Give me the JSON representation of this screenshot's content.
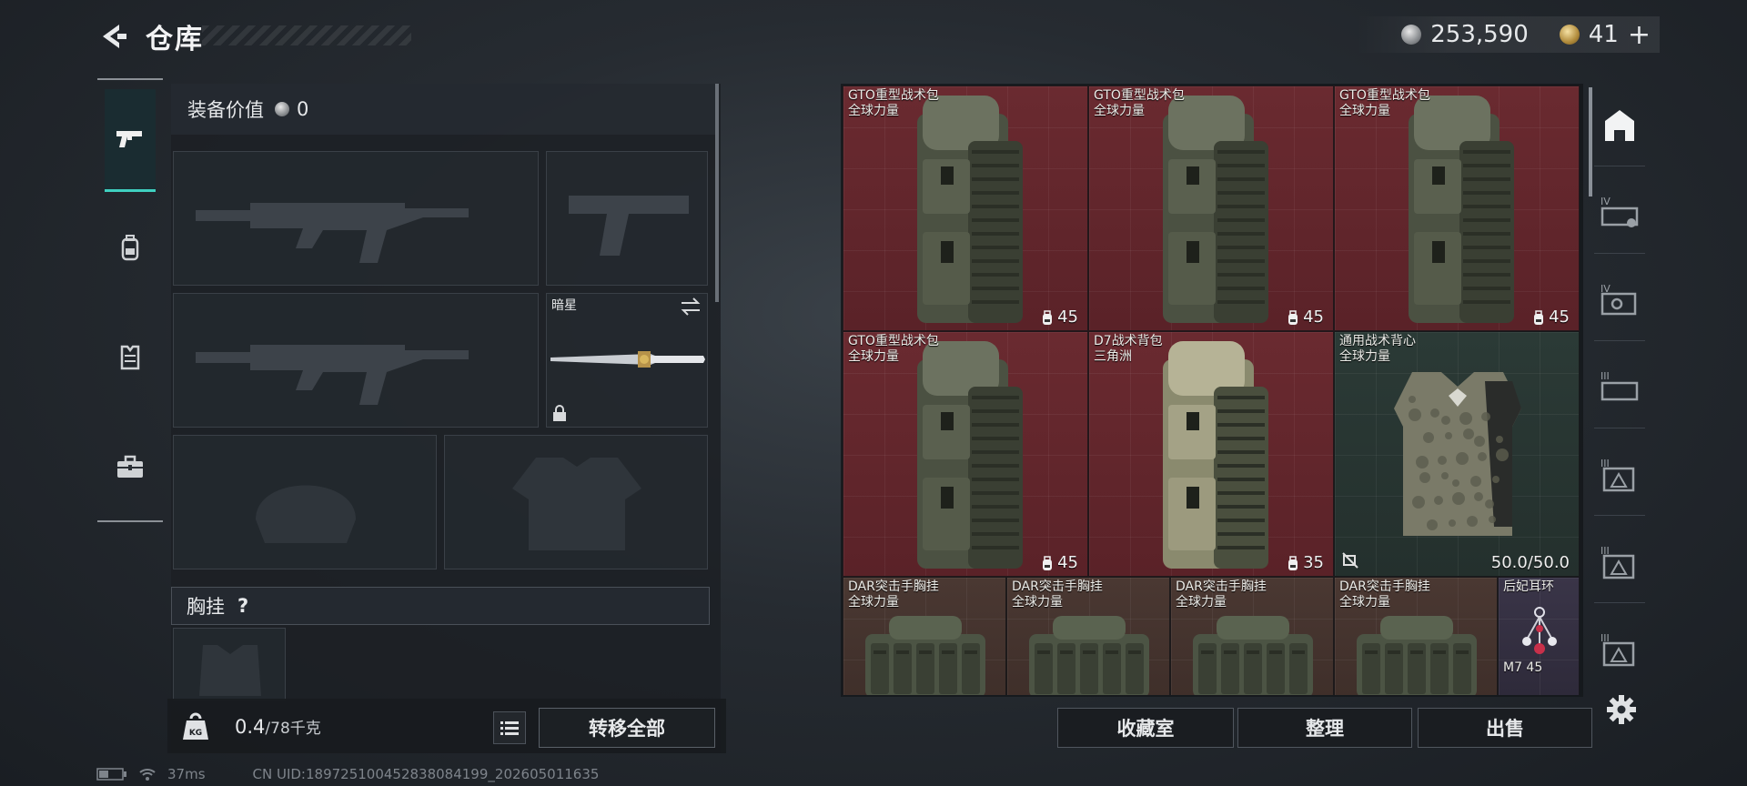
{
  "header": {
    "title": "仓库",
    "back_icon": "back-arrow-icon"
  },
  "currency": {
    "silver_amount": "253,590",
    "gold_amount": "41",
    "gold_add": "+"
  },
  "left_tabs": [
    {
      "icon": "pistol-icon",
      "active": true
    },
    {
      "icon": "backpack-icon",
      "active": false
    },
    {
      "icon": "vest-icon",
      "active": false
    },
    {
      "icon": "briefcase-icon",
      "active": false
    }
  ],
  "loadout": {
    "value_label": "装备价值",
    "value_amount": "0",
    "melee_name": "暗星",
    "chest_rig_label": "胸挂",
    "help_symbol": "?"
  },
  "weight": {
    "current": "0.4",
    "max": "/78千克",
    "kg_icon_label": "KG"
  },
  "buttons": {
    "transfer_all": "转移全部",
    "collection": "收藏室",
    "organize": "整理",
    "sell": "出售"
  },
  "inventory": {
    "items": [
      {
        "name": "GTO重型战术包",
        "sub": "全球力量",
        "count": "45",
        "bg": "red",
        "art": "backpack"
      },
      {
        "name": "GTO重型战术包",
        "sub": "全球力量",
        "count": "45",
        "bg": "red",
        "art": "backpack"
      },
      {
        "name": "GTO重型战术包",
        "sub": "全球力量",
        "count": "45",
        "bg": "red",
        "art": "backpack"
      },
      {
        "name": "GTO重型战术包",
        "sub": "全球力量",
        "count": "45",
        "bg": "red",
        "art": "backpack"
      },
      {
        "name": "D7战术背包",
        "sub": "三角洲",
        "count": "35",
        "bg": "red",
        "art": "backpack-tan"
      },
      {
        "name": "通用战术背心",
        "sub": "全球力量",
        "count": "50.0/50.0",
        "bg": "green",
        "art": "vest"
      },
      {
        "name": "DAR突击手胸挂",
        "sub": "全球力量",
        "bg": "brown",
        "art": "rig"
      },
      {
        "name": "DAR突击手胸挂",
        "sub": "全球力量",
        "bg": "brown",
        "art": "rig"
      },
      {
        "name": "DAR突击手胸挂",
        "sub": "全球力量",
        "bg": "brown",
        "art": "rig"
      },
      {
        "name": "DAR突击手胸挂",
        "sub": "全球力量",
        "bg": "brown",
        "art": "rig"
      },
      {
        "name": "后妃耳环",
        "sub": "M7 45",
        "bg": "purple",
        "art": "earring"
      }
    ]
  },
  "side_tabs": [
    {
      "icon": "storage-icon",
      "label": ""
    },
    {
      "icon": "tier-4-case-icon",
      "label": "IV"
    },
    {
      "icon": "tier-4-box-icon",
      "label": "IV"
    },
    {
      "icon": "tier-3-case-icon",
      "label": "III"
    },
    {
      "icon": "tier-3-box-icon",
      "label": "III"
    },
    {
      "icon": "tier-3-box-icon",
      "label": "III"
    },
    {
      "icon": "tier-3-box-icon",
      "label": "III"
    }
  ],
  "status": {
    "ping": "37ms",
    "uid": "CN UID:18972510045283808419​9_202605011635"
  },
  "colors": {
    "accent": "#3fd0c0",
    "item_red": "#5a2228",
    "item_green": "#24302d"
  }
}
